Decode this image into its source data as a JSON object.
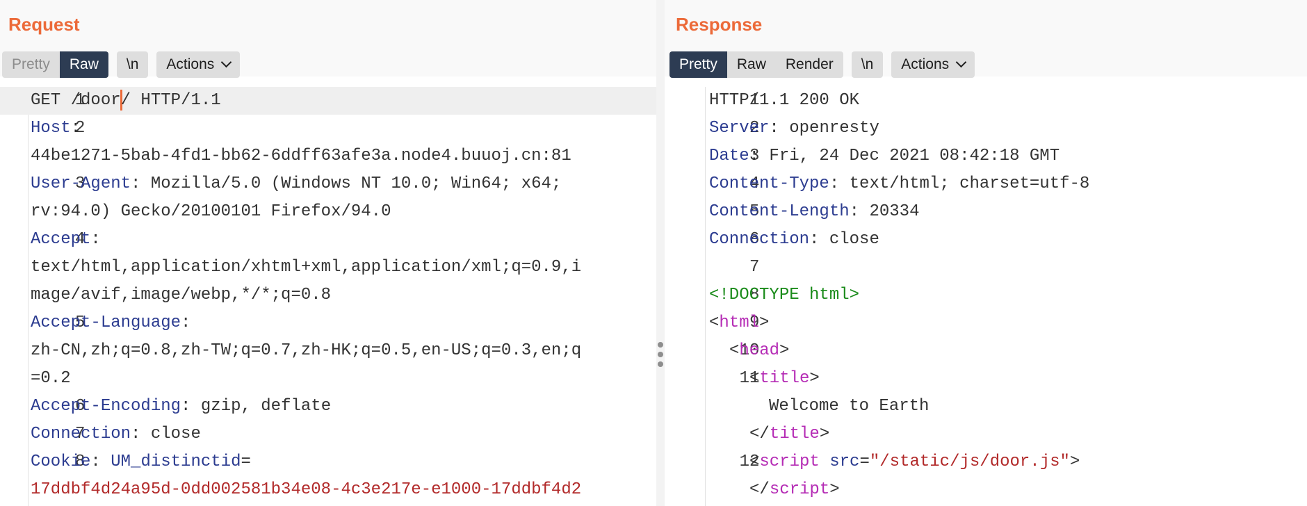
{
  "request": {
    "title": "Request",
    "buttons": {
      "pretty": "Pretty",
      "raw": "Raw",
      "newline": "\\n",
      "actions": "Actions"
    },
    "lines": [
      {
        "n": "1",
        "method": "GET /door",
        "rest": "/ HTTP/1.1"
      },
      {
        "n": "2",
        "key": "Host",
        "sep": ":"
      },
      {
        "cont": "44be1271-5bab-4fd1-bb62-6ddff63afe3a.node4.buuoj.cn:81"
      },
      {
        "n": "3",
        "key": "User-Agent",
        "sep": ": ",
        "val": "Mozilla/5.0 (Windows NT 10.0; Win64; x64;"
      },
      {
        "cont": "rv:94.0) Gecko/20100101 Firefox/94.0"
      },
      {
        "n": "4",
        "key": "Accept",
        "sep": ":"
      },
      {
        "cont": "text/html,application/xhtml+xml,application/xml;q=0.9,i"
      },
      {
        "cont": "mage/avif,image/webp,*/*;q=0.8"
      },
      {
        "n": "5",
        "key": "Accept-Language",
        "sep": ":"
      },
      {
        "cont": "zh-CN,zh;q=0.8,zh-TW;q=0.7,zh-HK;q=0.5,en-US;q=0.3,en;q"
      },
      {
        "cont": "=0.2"
      },
      {
        "n": "6",
        "key": "Accept-Encoding",
        "sep": ": ",
        "val": "gzip, deflate"
      },
      {
        "n": "7",
        "key": "Connection",
        "sep": ": ",
        "val": "close"
      },
      {
        "n": "8",
        "key": "Cookie",
        "sep": ": ",
        "ckey": "UM_distinctid",
        "ceq": "="
      },
      {
        "cred": "17ddbf4d24a95d-0dd002581b34e08-4c3e217e-e1000-17ddbf4d2"
      }
    ]
  },
  "response": {
    "title": "Response",
    "buttons": {
      "pretty": "Pretty",
      "raw": "Raw",
      "render": "Render",
      "newline": "\\n",
      "actions": "Actions"
    },
    "headers": [
      {
        "n": "1",
        "text": "HTTP/1.1 200 OK"
      },
      {
        "n": "2",
        "key": "Server",
        "val": "openresty"
      },
      {
        "n": "3",
        "key": "Date",
        "val": "Fri, 24 Dec 2021 08:42:18 GMT"
      },
      {
        "n": "4",
        "key": "Content-Type",
        "val": "text/html; charset=utf-8"
      },
      {
        "n": "5",
        "key": "Content-Length",
        "val": "20334"
      },
      {
        "n": "6",
        "key": "Connection",
        "val": "close"
      },
      {
        "n": "7",
        "text": ""
      }
    ],
    "html": {
      "line8_n": "8",
      "doctype": "<!DOCTYPE html>",
      "line9_n": "9",
      "html_open": "<",
      "html_tag": "html",
      "html_close": ">",
      "line10_n": "10",
      "head_open": "<",
      "head_tag": "head",
      "head_close": ">",
      "line11_n": "11",
      "title_open": "<",
      "title_tag": "title",
      "title_close": ">",
      "title_text": "Welcome to Earth",
      "title_end_open": "</",
      "title_end_tag": "title",
      "title_end_close": ">",
      "line12_n": "12",
      "script_open": "<",
      "script_tag": "script",
      "script_attr": "src",
      "script_eq": "=",
      "script_val": "\"/static/js/door.js\"",
      "script_close": ">",
      "script_end_open": "</",
      "script_end_tag": "script",
      "script_end_close": ">"
    }
  }
}
